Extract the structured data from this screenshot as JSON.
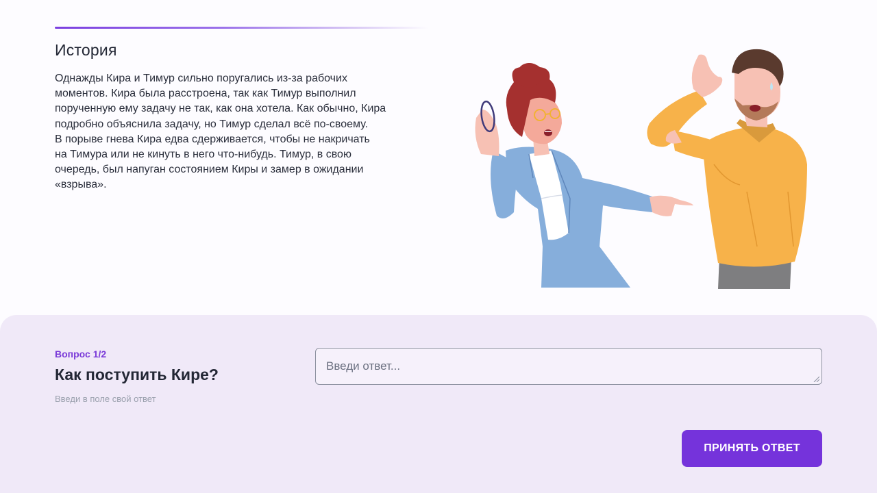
{
  "story": {
    "title": "История",
    "lines": [
      "Однажды Кира и Тимур сильно поругались из-за рабочих",
      "моментов. Кира была расстроена, так как Тимур выполнил",
      "порученную ему задачу не так, как она хотела. Как обычно, Кира",
      "подробно объяснила задачу, но Тимур сделал всё по-своему.",
      "В порыве гнева Кира едва сдерживается, чтобы не накричать",
      "на Тимура или не кинуть в него что-нибудь. Тимур, в свою",
      "очередь, был напуган состоянием Киры и замер в ожидании",
      "«взрыва»."
    ]
  },
  "question": {
    "counter": "Вопрос 1/2",
    "title": "Как поступить Кире?",
    "hint": "Введи в поле свой ответ"
  },
  "answer": {
    "placeholder": "Введи ответ...",
    "value": ""
  },
  "submit": {
    "label": "ПРИНЯТЬ ОТВЕТ"
  },
  "colors": {
    "accent": "#7533db",
    "panel": "#f0e9f8",
    "heading": "#232735"
  }
}
